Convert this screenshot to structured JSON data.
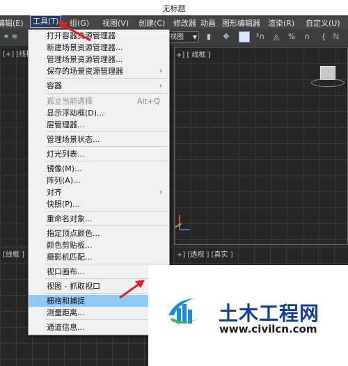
{
  "window": {
    "title": "无标题"
  },
  "menubar": {
    "items": [
      {
        "key": "edit",
        "label": "编辑(E)"
      },
      {
        "key": "tools",
        "label": "工具(T)"
      },
      {
        "key": "group",
        "label": "组(G)"
      },
      {
        "key": "views",
        "label": "视图(V)"
      },
      {
        "key": "create",
        "label": "创建(C)"
      },
      {
        "key": "modifiers",
        "label": "修改器"
      },
      {
        "key": "animation",
        "label": "动画"
      },
      {
        "key": "graph_editors",
        "label": "图形编辑器"
      },
      {
        "key": "rendering",
        "label": "渲染(R)"
      },
      {
        "key": "customize",
        "label": "自定义(U)"
      }
    ]
  },
  "toolbar": {
    "view_dropdown": "视图"
  },
  "viewports": {
    "top_left": "[+] [线框 ]",
    "top_right": "+] [ 线框 ]",
    "bottom_left": "[线框 ]",
    "bottom_right": "+] [透视 ] [真实 ]"
  },
  "tools_menu": {
    "items": [
      {
        "label": "打开容器资源管理器"
      },
      {
        "label": "新建场景资源管理器..."
      },
      {
        "label": "管理场景资源管理器..."
      },
      {
        "label": "保存的场景资源管理器",
        "submenu": "›"
      },
      {
        "label": "容器",
        "submenu": "›"
      },
      {
        "label": "孤立当前选择",
        "shortcut": "Alt+Q",
        "disabled": true
      },
      {
        "label": "显示浮动框(D)..."
      },
      {
        "label": "层管理器..."
      },
      {
        "label": "管理场景状态..."
      },
      {
        "label": "灯光列表..."
      },
      {
        "label": "镜像(M)..."
      },
      {
        "label": "阵列(A)..."
      },
      {
        "label": "对齐",
        "submenu": "›"
      },
      {
        "label": "快照(P)..."
      },
      {
        "label": "重命名对象..."
      },
      {
        "label": "指定顶点颜色..."
      },
      {
        "label": "颜色剪贴板..."
      },
      {
        "label": "摄影机匹配..."
      },
      {
        "label": "视口画布..."
      },
      {
        "label": "视图 - 抓取视口",
        "submenu": "›"
      },
      {
        "label": "栅格和捕捉",
        "submenu": "›",
        "highlighted": true
      },
      {
        "label": "测量距离..."
      },
      {
        "label": "通道信息..."
      }
    ]
  },
  "watermark": {
    "text_cn": "土木工程网",
    "url": "www.civilcn.com"
  },
  "colors": {
    "highlight": "#91c9f7",
    "annotation_arrow": "#e02020",
    "brand": "#123f95"
  }
}
